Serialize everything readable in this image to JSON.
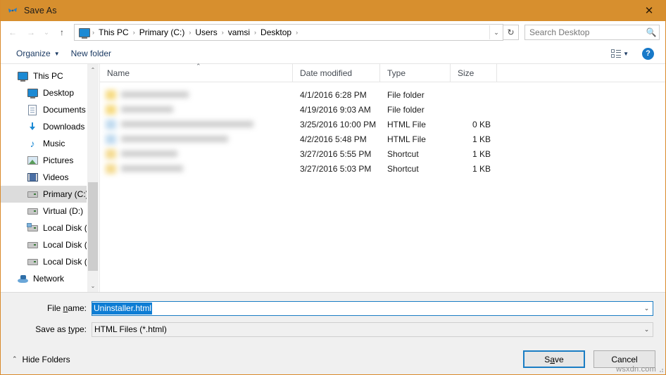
{
  "window": {
    "title": "Save As",
    "title_icon": "app-butterfly-icon",
    "close_label": "✕",
    "accent_titlebar": "#d78f2e"
  },
  "nav": {
    "back": "←",
    "forward": "→",
    "recent": "⌄",
    "up": "↑",
    "refresh": "↻",
    "breadcrumb_dropdown": "⌄",
    "breadcrumb_root_icon": "this-pc-icon",
    "separator": "›",
    "breadcrumbs": [
      "This PC",
      "Primary (C:)",
      "Users",
      "vamsi",
      "Desktop"
    ]
  },
  "search": {
    "placeholder": "Search Desktop",
    "value": "",
    "icon": "🔍"
  },
  "toolbar": {
    "organize_label": "Organize",
    "organize_caret": "▼",
    "new_folder_label": "New folder",
    "view_caret": "▼",
    "help_label": "?"
  },
  "sidebar": {
    "items": [
      {
        "label": "This PC",
        "icon": "monitor-icon",
        "level": 0,
        "selected": false
      },
      {
        "label": "Desktop",
        "icon": "monitor-icon",
        "level": 1,
        "selected": false
      },
      {
        "label": "Documents",
        "icon": "document-icon",
        "level": 1,
        "selected": false
      },
      {
        "label": "Downloads",
        "icon": "download-icon",
        "level": 1,
        "selected": false
      },
      {
        "label": "Music",
        "icon": "music-icon",
        "level": 1,
        "selected": false
      },
      {
        "label": "Pictures",
        "icon": "picture-icon",
        "level": 1,
        "selected": false
      },
      {
        "label": "Videos",
        "icon": "video-icon",
        "level": 1,
        "selected": false
      },
      {
        "label": "Primary (C:)",
        "icon": "drive-icon",
        "level": 1,
        "selected": true
      },
      {
        "label": "Virtual (D:)",
        "icon": "drive-icon",
        "level": 1,
        "selected": false
      },
      {
        "label": "Local Disk (E:)",
        "icon": "network-drive-icon",
        "level": 1,
        "selected": false
      },
      {
        "label": "Local Disk (F:)",
        "icon": "drive-icon",
        "level": 1,
        "selected": false
      },
      {
        "label": "Local Disk (G:)",
        "icon": "drive-icon",
        "level": 1,
        "selected": false
      },
      {
        "label": "Network",
        "icon": "network-icon",
        "level": 0,
        "selected": false
      }
    ],
    "scroll_up": "⌃",
    "scroll_down": "⌄"
  },
  "filelist": {
    "columns": [
      "Name",
      "Date modified",
      "Type",
      "Size"
    ],
    "sort_caret": "⌃",
    "rows": [
      {
        "name": "",
        "name_redacted": true,
        "icon": "folder-icon",
        "date": "4/1/2016 6:28 PM",
        "type": "File folder",
        "size": ""
      },
      {
        "name": "",
        "name_redacted": true,
        "icon": "folder-icon",
        "date": "4/19/2016 9:03 AM",
        "type": "File folder",
        "size": ""
      },
      {
        "name": "",
        "name_redacted": true,
        "icon": "html-file-icon",
        "date": "3/25/2016 10:00 PM",
        "type": "HTML File",
        "size": "0 KB"
      },
      {
        "name": "",
        "name_redacted": true,
        "icon": "html-file-icon",
        "date": "4/2/2016 5:48 PM",
        "type": "HTML File",
        "size": "1 KB"
      },
      {
        "name": "",
        "name_redacted": true,
        "icon": "shortcut-icon",
        "date": "3/27/2016 5:55 PM",
        "type": "Shortcut",
        "size": "1 KB"
      },
      {
        "name": "",
        "name_redacted": true,
        "icon": "shortcut-icon",
        "date": "3/27/2016 5:03 PM",
        "type": "Shortcut",
        "size": "1 KB"
      }
    ]
  },
  "form": {
    "file_name_label_pre": "File ",
    "file_name_label_mnemonic": "n",
    "file_name_label_post": "ame:",
    "file_name_value": "Uninstaller.html",
    "file_name_selected": true,
    "save_type_label_pre": "Save as ",
    "save_type_label_mnemonic": "t",
    "save_type_label_post": "ype:",
    "save_type_value": "HTML Files (*.html)",
    "combo_arrow": "⌄"
  },
  "footer": {
    "hide_folders_caret": "⌃",
    "hide_folders_label": "Hide Folders",
    "save_pre": "S",
    "save_mnemonic": "a",
    "save_post": "ve",
    "save_label": "Save",
    "cancel_label": "Cancel",
    "watermark": "wsxdn.com"
  }
}
